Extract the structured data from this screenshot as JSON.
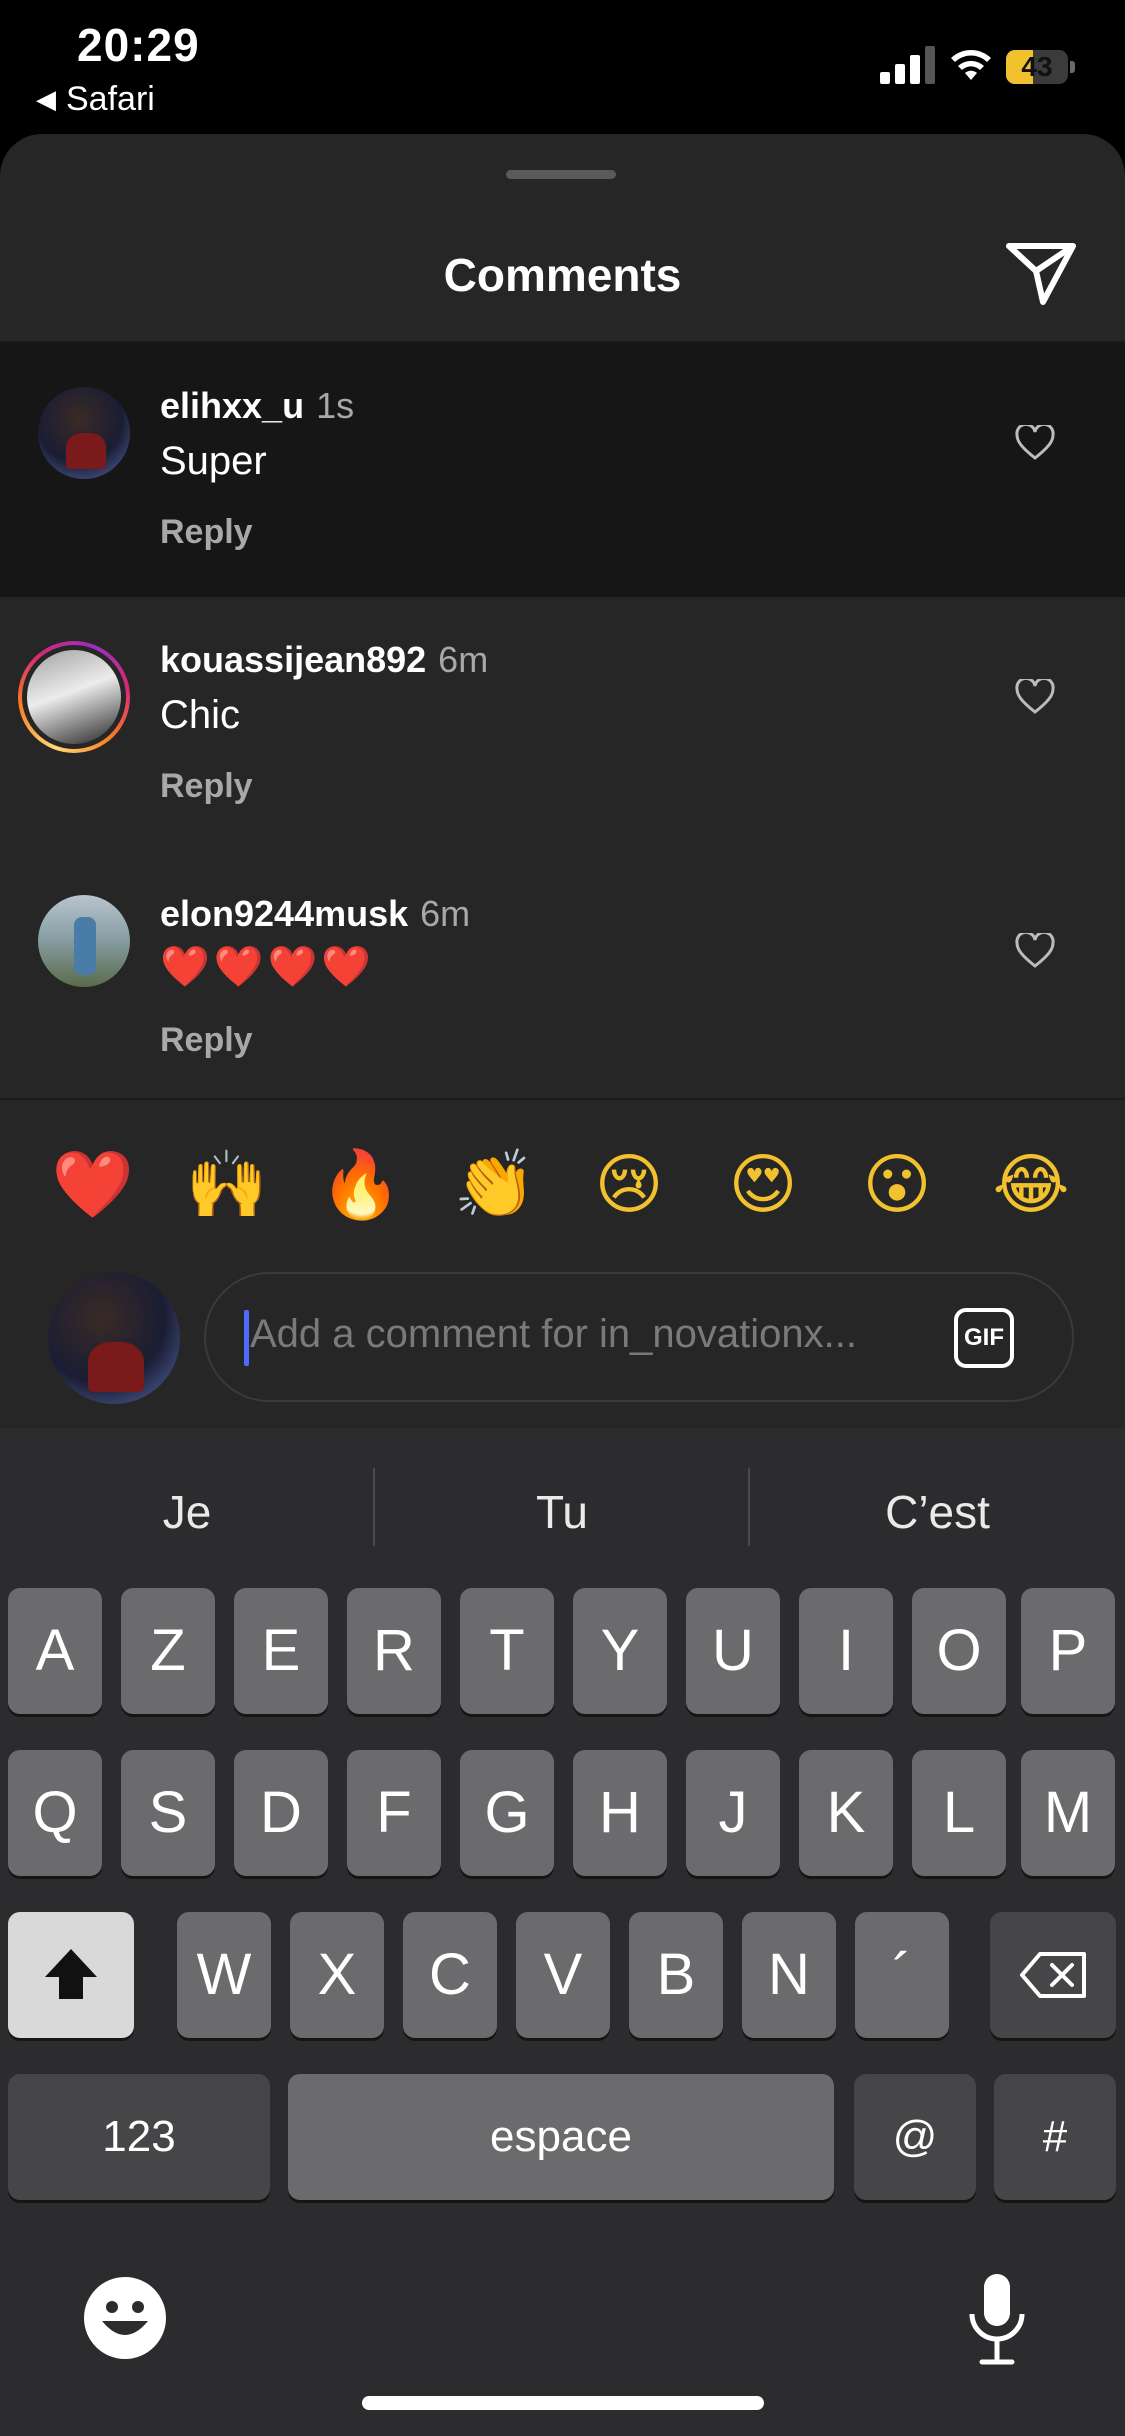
{
  "status": {
    "time": "20:29",
    "back_label": "Safari",
    "battery": "43",
    "battery_level": 0.43
  },
  "sheet": {
    "title": "Comments"
  },
  "comments": [
    {
      "username": "elihxx_u",
      "time": "1s",
      "text": "Super",
      "reply": "Reply"
    },
    {
      "username": "kouassijean892",
      "time": "6m",
      "text": "Chic",
      "reply": "Reply"
    },
    {
      "username": "elon9244musk",
      "time": "6m",
      "text": "❤️❤️❤️❤️",
      "reply": "Reply"
    }
  ],
  "emojis": [
    "❤️",
    "🙌",
    "🔥",
    "👏",
    "😢",
    "😍",
    "😮",
    "😂"
  ],
  "composer": {
    "placeholder": "Add a comment for in_novationx...",
    "gif_label": "GIF"
  },
  "keyboard": {
    "suggestions": [
      "Je",
      "Tu",
      "C’est"
    ],
    "row1": [
      "A",
      "Z",
      "E",
      "R",
      "T",
      "Y",
      "U",
      "I",
      "O",
      "P"
    ],
    "row2": [
      "Q",
      "S",
      "D",
      "F",
      "G",
      "H",
      "J",
      "K",
      "L",
      "M"
    ],
    "row3": [
      "W",
      "X",
      "C",
      "V",
      "B",
      "N",
      "´"
    ],
    "numbers_key": "123",
    "space_key": "espace",
    "at_key": "@",
    "hash_key": "#"
  }
}
